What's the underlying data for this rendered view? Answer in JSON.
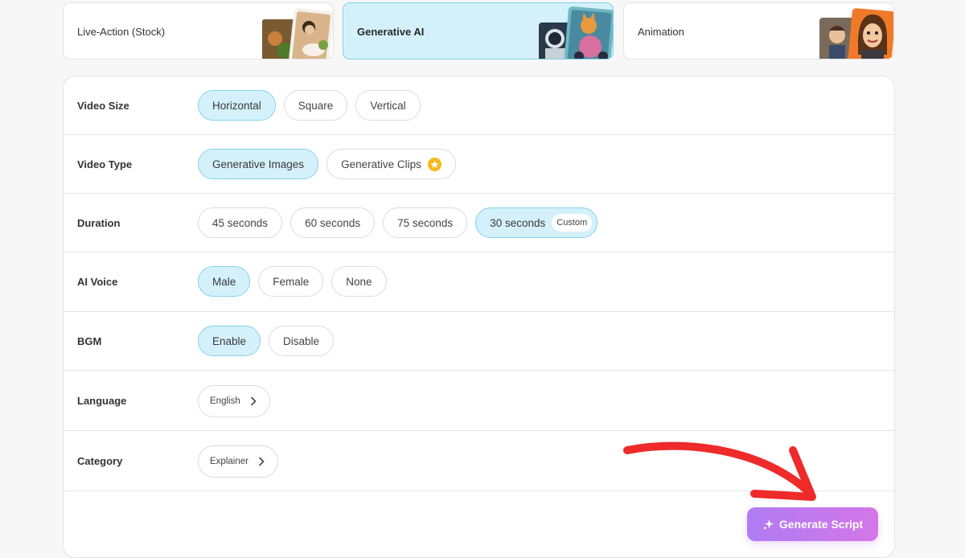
{
  "styles": [
    {
      "label": "Live-Action (Stock)",
      "active": false,
      "thumb": "food-photo-thumbnail"
    },
    {
      "label": "Generative AI",
      "active": true,
      "thumb": "ai-astronaut-cat-thumbnail"
    },
    {
      "label": "Animation",
      "active": false,
      "thumb": "cartoon-characters-thumbnail"
    }
  ],
  "settings": {
    "video_size": {
      "label": "Video Size",
      "options": [
        "Horizontal",
        "Square",
        "Vertical"
      ],
      "selected": "Horizontal"
    },
    "video_type": {
      "label": "Video Type",
      "options": [
        "Generative Images",
        "Generative Clips"
      ],
      "selected": "Generative Images",
      "premium_icon": "star-icon"
    },
    "duration": {
      "label": "Duration",
      "options": [
        "45 seconds",
        "60 seconds",
        "75 seconds",
        "30 seconds"
      ],
      "selected": "30 seconds",
      "custom_tag": "Custom"
    },
    "ai_voice": {
      "label": "AI Voice",
      "options": [
        "Male",
        "Female",
        "None"
      ],
      "selected": "Male"
    },
    "bgm": {
      "label": "BGM",
      "options": [
        "Enable",
        "Disable"
      ],
      "selected": "Enable"
    },
    "language": {
      "label": "Language",
      "value": "English"
    },
    "category": {
      "label": "Category",
      "value": "Explainer"
    }
  },
  "generate_button": {
    "label": "Generate Script",
    "icon": "sparkle-icon"
  },
  "colors": {
    "accent_bg": "#d4f1fb",
    "accent_border": "#86d2ea",
    "button_from": "#b07cf3",
    "button_to": "#d476e8",
    "arrow": "#ee2a2a"
  }
}
